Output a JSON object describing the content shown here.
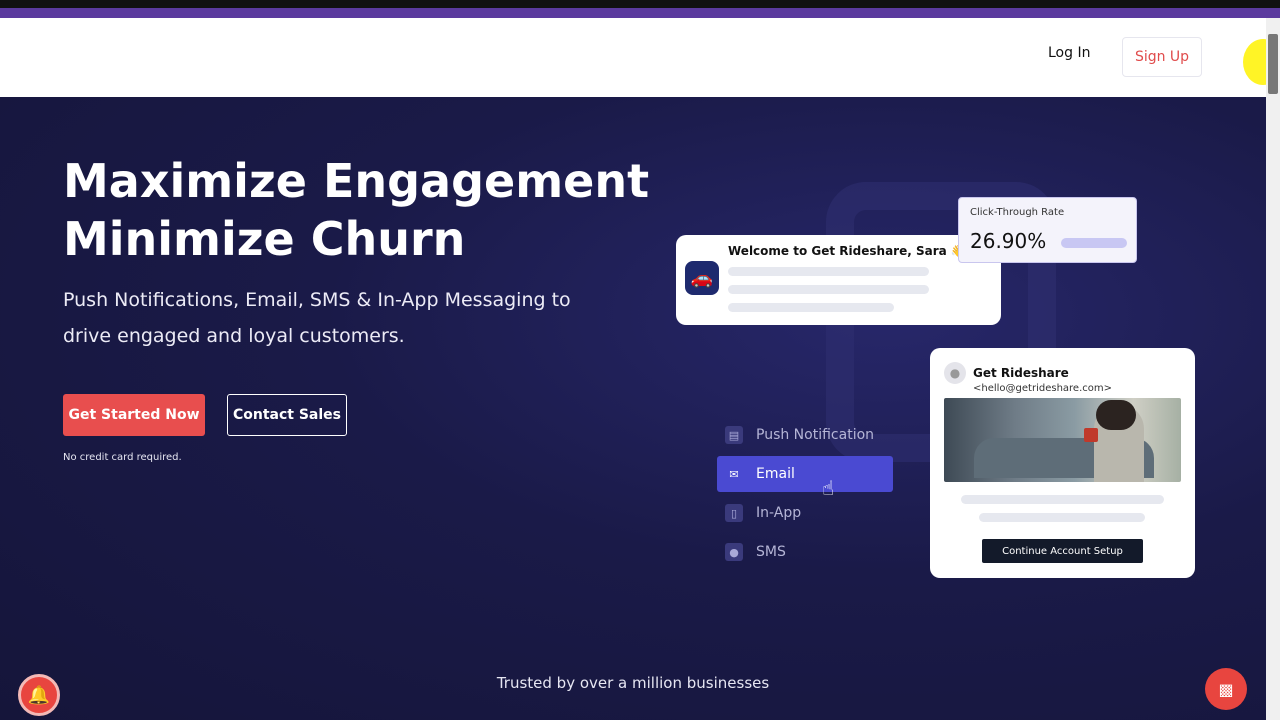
{
  "header": {
    "login_label": "Log In",
    "signup_label": "Sign Up"
  },
  "hero": {
    "headline_line1": "Maximize Engagement",
    "headline_line2": "Minimize Churn",
    "subline": "Push Notifications, Email, SMS & In-App Messaging to drive engaged and loyal customers.",
    "primary_cta": "Get Started Now",
    "secondary_cta": "Contact Sales",
    "note": "No credit card required."
  },
  "welcome_card": {
    "title": "Welcome to Get Rideshare, Sara 👋"
  },
  "ctr_card": {
    "label": "Click-Through Rate",
    "value": "26.90%"
  },
  "channels": [
    {
      "label": "Push Notification",
      "icon": "push-icon",
      "active": false
    },
    {
      "label": "Email",
      "icon": "envelope-icon",
      "active": true
    },
    {
      "label": "In-App",
      "icon": "in-app-icon",
      "active": false
    },
    {
      "label": "SMS",
      "icon": "chat-bubble-icon",
      "active": false
    }
  ],
  "email_card": {
    "sender_name": "Get Rideshare",
    "sender_address": "<hello@getrideshare.com>",
    "cta_label": "Continue Account Setup"
  },
  "footer": {
    "trusted_text": "Trusted by over a million businesses"
  },
  "colors": {
    "hero_bg": "#17173f",
    "accent_red": "#e84e4e",
    "active_channel": "#4a4ad2",
    "topbar": "#5b3a9e"
  }
}
